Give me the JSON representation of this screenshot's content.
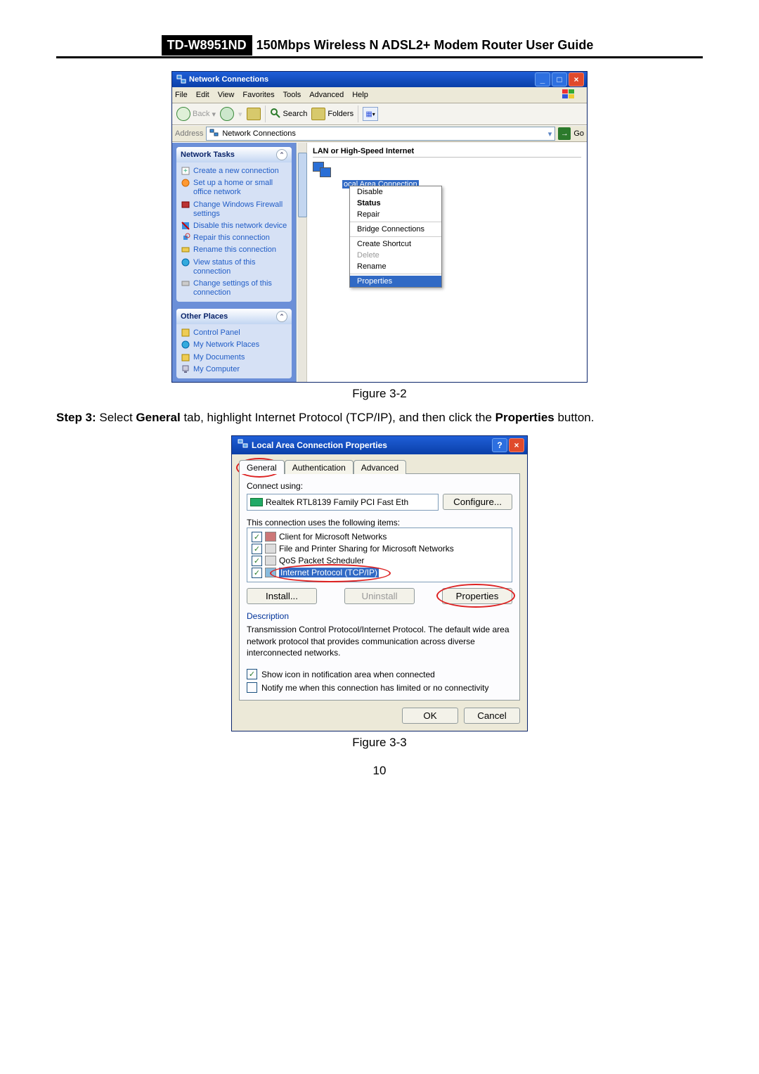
{
  "header": {
    "model": "TD-W8951ND",
    "title": "150Mbps Wireless N ADSL2+ Modem Router User Guide"
  },
  "figure32_caption": "Figure 3-2",
  "figure33_caption": "Figure 3-3",
  "page_number": "10",
  "step3": {
    "label": "Step 3:",
    "pre": "Select",
    "tab_ref": "General",
    "mid": "tab, highlight Internet Protocol (TCP/IP), and then click the",
    "prop_ref": "Properties",
    "post": "button."
  },
  "ncwin": {
    "title": "Network Connections",
    "menu": {
      "file": "File",
      "edit": "Edit",
      "view": "View",
      "favorites": "Favorites",
      "tools": "Tools",
      "advanced": "Advanced",
      "help": "Help"
    },
    "toolbar": {
      "back": "Back",
      "search": "Search",
      "folders": "Folders"
    },
    "address_label": "Address",
    "address_value": "Network Connections",
    "go": "Go",
    "tasks_head": "Network Tasks",
    "tasks": {
      "create": "Create a new connection",
      "home": "Set up a home or small office network",
      "firewall": "Change Windows Firewall settings",
      "disable": "Disable this network device",
      "repair": "Repair this connection",
      "rename": "Rename this connection",
      "status": "View status of this connection",
      "change": "Change settings of this connection"
    },
    "other_head": "Other Places",
    "other": {
      "cpanel": "Control Panel",
      "netplaces": "My Network Places",
      "docs": "My Documents",
      "mycomp": "My Computer"
    },
    "section": "LAN or High-Speed Internet",
    "selected_label": "ocal Area Connection",
    "ctx": {
      "disable": "Disable",
      "status": "Status",
      "repair": "Repair",
      "bridge": "Bridge Connections",
      "shortcut": "Create Shortcut",
      "delete": "Delete",
      "rename": "Rename",
      "properties": "Properties"
    }
  },
  "props": {
    "title": "Local Area Connection Properties",
    "tabs": {
      "general": "General",
      "auth": "Authentication",
      "adv": "Advanced"
    },
    "connect_using": "Connect using:",
    "adapter": "Realtek RTL8139 Family PCI Fast Eth",
    "configure": "Configure...",
    "uses_label": "This connection uses the following items:",
    "items": {
      "client": "Client for Microsoft Networks",
      "fileshare": "File and Printer Sharing for Microsoft Networks",
      "qos": "QoS Packet Scheduler",
      "tcpip": "Internet Protocol (TCP/IP)"
    },
    "install": "Install...",
    "uninstall": "Uninstall",
    "properties": "Properties",
    "desc_label": "Description",
    "desc_text": "Transmission Control Protocol/Internet Protocol. The default wide area network protocol that provides communication across diverse interconnected networks.",
    "show_icon": "Show icon in notification area when connected",
    "notify": "Notify me when this connection has limited or no connectivity",
    "ok": "OK",
    "cancel": "Cancel"
  }
}
